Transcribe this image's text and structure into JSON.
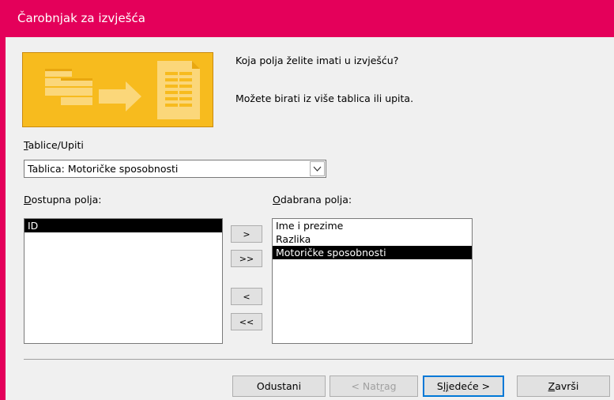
{
  "window": {
    "title": "Čarobnjak za izvješća",
    "accent_color": "#e4005a"
  },
  "intro": {
    "question": "Koja polja želite imati u izvješću?",
    "hint": "Možete birati iz više tablica ili upita."
  },
  "tables": {
    "label_accel": "T",
    "label_rest": "ablice/Upiti",
    "selected": "Tablica: Motoričke sposobnosti"
  },
  "available": {
    "label_accel": "D",
    "label_rest": "ostupna polja:",
    "items": [
      "ID"
    ]
  },
  "selected_fields": {
    "label_accel": "O",
    "label_rest": "dabrana polja:",
    "items": [
      "Ime i prezime",
      "Razlika",
      "Motoričke sposobnosti"
    ]
  },
  "move_buttons": {
    "add": ">",
    "add_all": ">>",
    "remove": "<",
    "remove_all": "<<"
  },
  "footer": {
    "cancel": "Odustani",
    "back_pre": "< Nat",
    "back_accel": "r",
    "back_post": "ag",
    "next_pre": "S",
    "next_accel": "lj",
    "next_post": "edeće >",
    "finish_accel": "Z",
    "finish_post": "avrši"
  }
}
